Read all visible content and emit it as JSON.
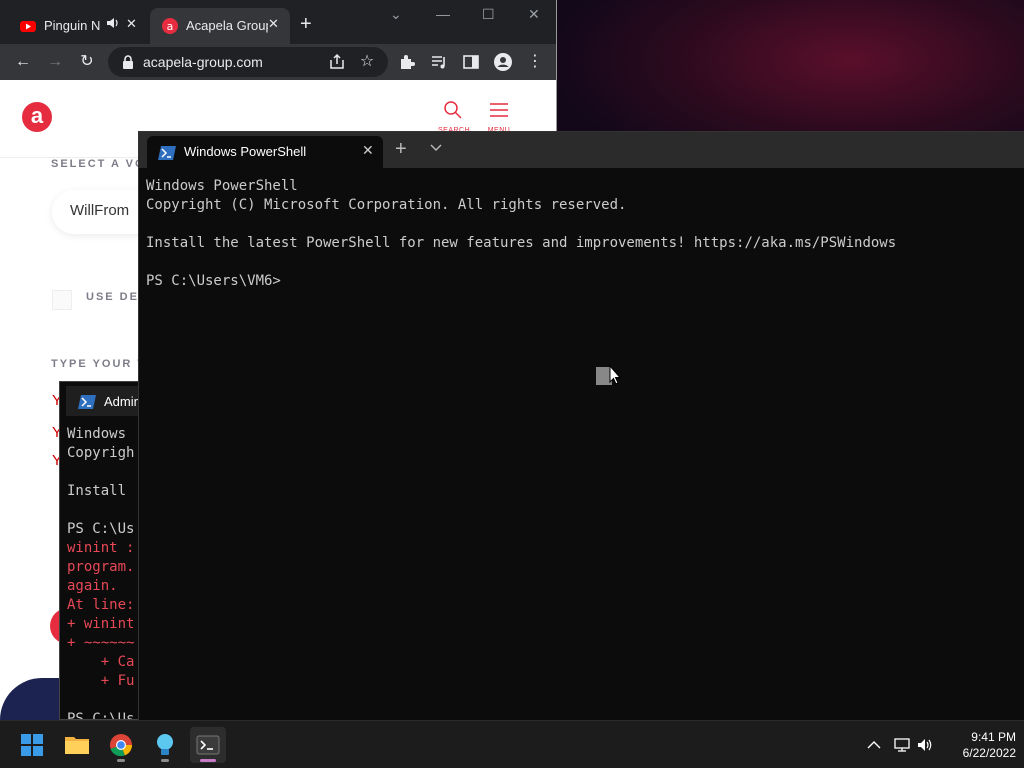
{
  "browser": {
    "tabs": [
      {
        "title": "Pinguin N",
        "favicon": "youtube-icon",
        "audio": "speaker-icon"
      },
      {
        "title": "Acapela Group",
        "favicon": "acapela-icon"
      }
    ],
    "url": "acapela-group.com"
  },
  "website": {
    "logo_letter": "a",
    "search_caption": "SEARCH",
    "menu_caption": "MENU",
    "select_voice_label": "SELECT A VO",
    "voice_value": "WillFrom",
    "use_label": "USE DEF",
    "type_label": "TYPE YOUR T",
    "text_lines": [
      "Y",
      "Y",
      "Y"
    ]
  },
  "admin_terminal": {
    "tab_title": "Admin",
    "lines": [
      {
        "text": "Windows ",
        "error": false
      },
      {
        "text": "Copyrigh",
        "error": false
      },
      {
        "text": "",
        "error": false
      },
      {
        "text": "Install ",
        "error": false
      },
      {
        "text": "",
        "error": false
      },
      {
        "text": "PS C:\\Us",
        "error": false
      },
      {
        "text": "winint :",
        "error": true
      },
      {
        "text": "program.",
        "error": true
      },
      {
        "text": "again.",
        "error": true
      },
      {
        "text": "At line:",
        "error": true
      },
      {
        "text": "+ winint",
        "error": true
      },
      {
        "text": "+ ~~~~~~",
        "error": true
      },
      {
        "text": "    + Ca",
        "error": true
      },
      {
        "text": "    + Fu",
        "error": true
      },
      {
        "text": "",
        "error": false
      },
      {
        "text": "PS C:\\Us",
        "error": false
      }
    ]
  },
  "terminal": {
    "tab_title": "Windows PowerShell",
    "lines": [
      "Windows PowerShell",
      "Copyright (C) Microsoft Corporation. All rights reserved.",
      "",
      "Install the latest PowerShell for new features and improvements! https://aka.ms/PSWindows",
      "",
      "PS C:\\Users\\VM6>"
    ]
  },
  "taskbar": {
    "apps": [
      "start-icon",
      "file-explorer-icon",
      "chrome-icon",
      "tips-icon",
      "terminal-icon"
    ],
    "time": "9:41 PM",
    "date": "6/22/2022"
  },
  "colors": {
    "acapela_red": "#e52d3f",
    "terminal_bg": "#0c0c0c",
    "terminal_text": "#cccccc",
    "terminal_error": "#e74856",
    "chrome_dark": "#202124"
  }
}
